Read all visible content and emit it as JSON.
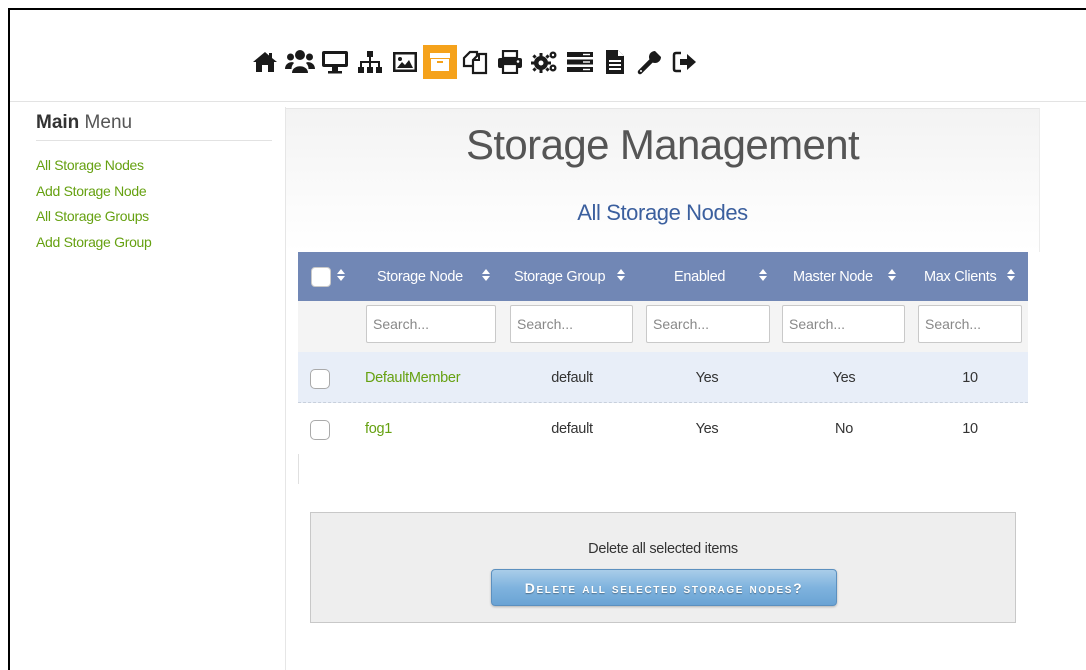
{
  "nav": {
    "icons": [
      "home-icon",
      "users-icon",
      "monitor-icon",
      "sitemap-icon",
      "image-icon",
      "archive-icon",
      "copy-icon",
      "print-icon",
      "cogs-icon",
      "server-icon",
      "file-icon",
      "wrench-icon",
      "logout-icon"
    ],
    "active": "archive-icon"
  },
  "sidebar": {
    "title_bold": "Main",
    "title_rest": " Menu",
    "items": [
      {
        "label": "All Storage Nodes"
      },
      {
        "label": "Add Storage Node"
      },
      {
        "label": "All Storage Groups"
      },
      {
        "label": "Add Storage Group"
      }
    ]
  },
  "main": {
    "title": "Storage Management",
    "subtitle": "All Storage Nodes"
  },
  "table": {
    "columns": [
      "Storage Node",
      "Storage Group",
      "Enabled",
      "Master Node",
      "Max Clients"
    ],
    "search_placeholder": "Search...",
    "rows": [
      {
        "node": "DefaultMember",
        "group": "default",
        "enabled": "Yes",
        "master": "Yes",
        "max_clients": "10"
      },
      {
        "node": "fog1",
        "group": "default",
        "enabled": "Yes",
        "master": "No",
        "max_clients": "10"
      }
    ]
  },
  "actions": {
    "label": "Delete all selected items",
    "button": "Delete all selected storage nodes?"
  },
  "colors": {
    "accent_orange": "#f5a21b",
    "table_header": "#7187b5",
    "link_green": "#66a111",
    "subtitle_blue": "#3b5f9e"
  }
}
